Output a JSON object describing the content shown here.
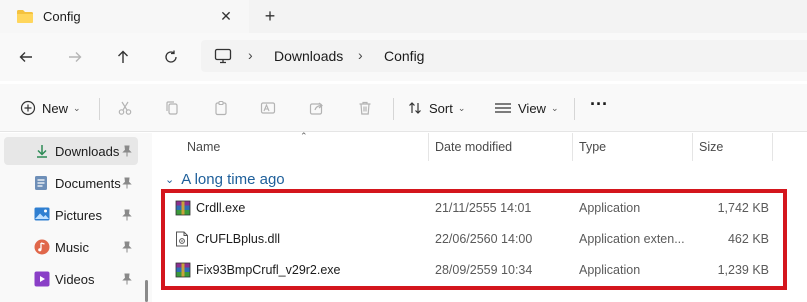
{
  "tab": {
    "title": "Config",
    "close_label": "✕",
    "newtab_label": "+"
  },
  "address": {
    "crumbs": [
      "Downloads",
      "Config"
    ],
    "separator": "›"
  },
  "commands": {
    "new_label": "New",
    "sort_label": "Sort",
    "view_label": "View",
    "more_label": "···"
  },
  "sidebar": {
    "items": [
      {
        "label": "Downloads",
        "icon": "download-icon",
        "selected": true
      },
      {
        "label": "Documents",
        "icon": "documents-icon",
        "selected": false
      },
      {
        "label": "Pictures",
        "icon": "pictures-icon",
        "selected": false
      },
      {
        "label": "Music",
        "icon": "music-icon",
        "selected": false
      },
      {
        "label": "Videos",
        "icon": "videos-icon",
        "selected": false
      }
    ]
  },
  "columns": {
    "name": "Name",
    "date": "Date modified",
    "type": "Type",
    "size": "Size"
  },
  "group": {
    "label": "A long time ago"
  },
  "files": [
    {
      "name": "Crdll.exe",
      "date": "21/11/2555 14:01",
      "type": "Application",
      "size": "1,742 KB",
      "icon": "winrar-exe-icon"
    },
    {
      "name": "CrUFLBplus.dll",
      "date": "22/06/2560 14:00",
      "type": "Application exten...",
      "size": "462 KB",
      "icon": "dll-file-icon"
    },
    {
      "name": "Fix93BmpCrufl_v29r2.exe",
      "date": "28/09/2559 10:34",
      "type": "Application",
      "size": "1,239 KB",
      "icon": "winrar-exe-icon"
    }
  ],
  "colors": {
    "accent": "#1e5f9a",
    "highlight": "#d4161d",
    "folder": "#f4c23f"
  }
}
